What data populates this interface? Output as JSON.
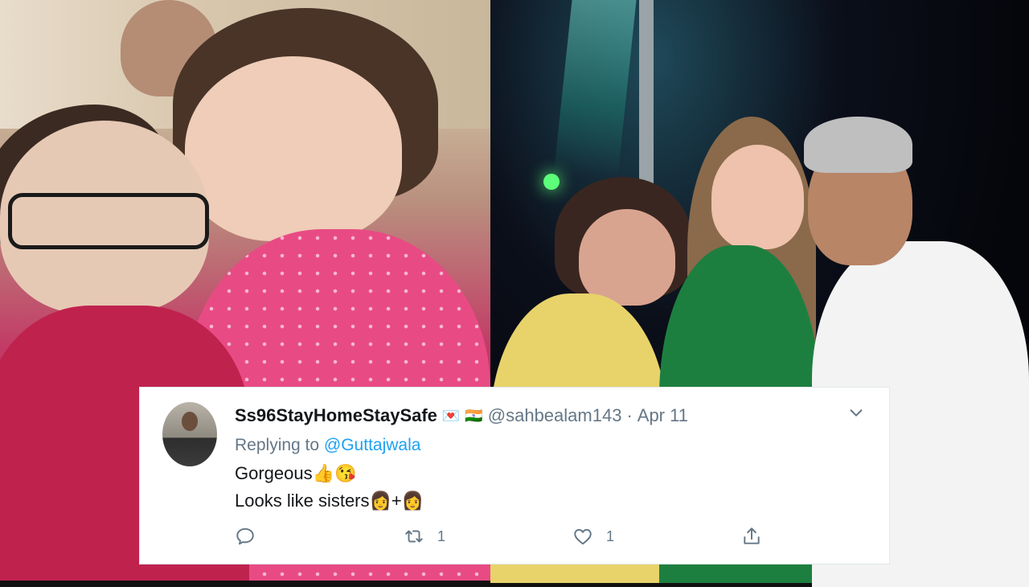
{
  "tweet": {
    "display_name": "Ss96StayHomeStaySafe",
    "name_emoji_1": "💌",
    "name_emoji_2": "🇮🇳",
    "handle": "@sahbealam143",
    "separator": "·",
    "date": "Apr 11",
    "replying_prefix": "Replying to",
    "replying_to": "@Guttajwala",
    "line1_text": "Gorgeous",
    "line1_emoji": "👍😘",
    "line2_text": "Looks like sisters",
    "line2_emoji_a": "👩",
    "line2_plus": "+",
    "line2_emoji_b": "👩",
    "retweet_count": "1",
    "like_count": "1"
  },
  "icons": {
    "reply": "reply-icon",
    "retweet": "retweet-icon",
    "like": "heart-icon",
    "share": "share-icon",
    "menu": "chevron-down-icon"
  },
  "colors": {
    "link": "#1da1f2",
    "muted": "#657786",
    "text": "#14171a",
    "card": "#ffffff"
  }
}
